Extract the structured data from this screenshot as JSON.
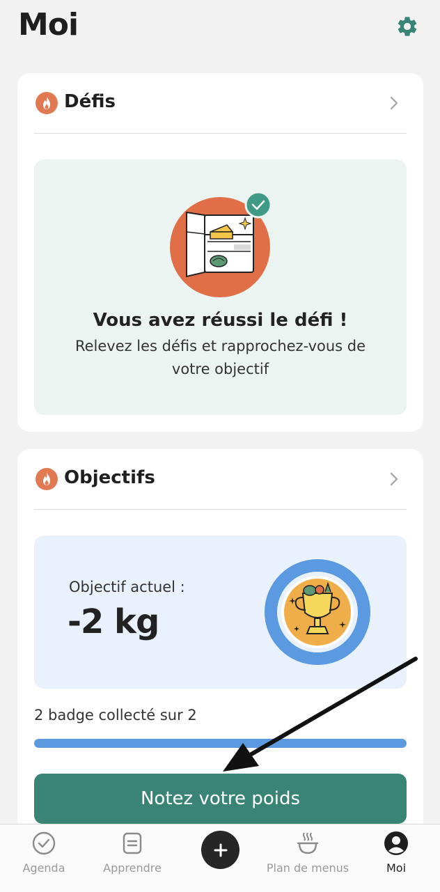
{
  "header": {
    "title": "Moi",
    "settings_icon": "gear-icon",
    "accent_color": "#3a8476"
  },
  "challenges": {
    "title": "Défis",
    "icon": "flame-icon",
    "banner_title": "Vous avez réussi le défi !",
    "banner_subtitle": "Relevez les défis et rapprochez-vous de votre objectif",
    "illustration": "fridge-illustration"
  },
  "goals": {
    "title": "Objectifs",
    "icon": "flame-icon",
    "current_label": "Objectif actuel :",
    "current_value": "-2 kg",
    "illustration": "trophy-badge",
    "badges_text": "2 badge collecté sur 2",
    "badges_collected": 2,
    "badges_total": 2,
    "progress_fraction": 1.0,
    "cta_label": "Notez votre poids"
  },
  "bottom_nav": {
    "items": [
      {
        "label": "Agenda",
        "icon": "check-circle-icon"
      },
      {
        "label": "Apprendre",
        "icon": "document-icon"
      },
      {
        "label": "",
        "icon": "plus-icon"
      },
      {
        "label": "Plan de menus",
        "icon": "bowl-icon"
      },
      {
        "label": "Moi",
        "icon": "profile-icon"
      }
    ],
    "active": "Moi"
  }
}
